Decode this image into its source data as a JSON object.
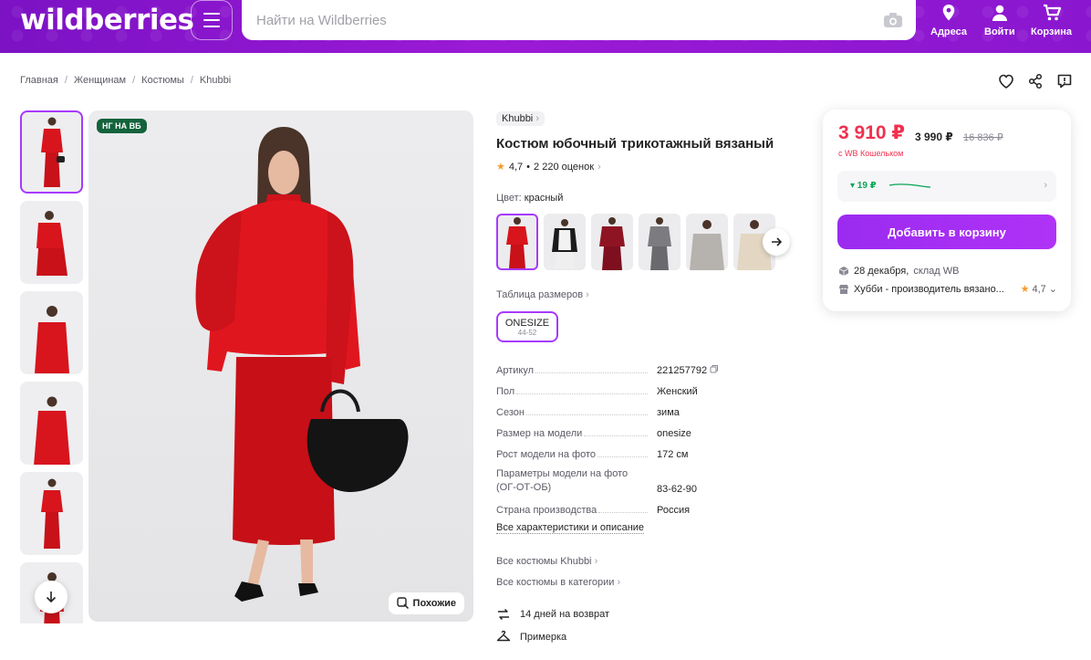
{
  "header": {
    "logo": "wildberries",
    "search_placeholder": "Найти на Wildberries",
    "addresses_label": "Адреса",
    "login_label": "Войти",
    "cart_label": "Корзина"
  },
  "breadcrumbs": [
    "Главная",
    "Женщинам",
    "Костюмы",
    "Khubbi"
  ],
  "gallery": {
    "badge": "НГ НА ВБ",
    "similar_label": "Похожие"
  },
  "product": {
    "brand": "Khubbi",
    "title": "Костюм юбочный трикотажный вязаный",
    "rating": "4,7",
    "reviews": "2 220 оценок",
    "color_label": "Цвет:",
    "color_value": "красный",
    "size_table_label": "Таблица размеров",
    "size": {
      "name": "ONESIZE",
      "range": "44-52"
    },
    "specs": [
      {
        "key": "Артикул",
        "value": "221257792"
      },
      {
        "key": "Пол",
        "value": "Женский"
      },
      {
        "key": "Сезон",
        "value": "зима"
      },
      {
        "key": "Размер на модели",
        "value": "onesize"
      },
      {
        "key": "Рост модели на фото",
        "value": "172 см"
      },
      {
        "key": "Параметры модели на фото (ОГ-ОТ-ОБ)",
        "value": "83-62-90"
      },
      {
        "key": "Страна производства",
        "value": "Россия"
      }
    ],
    "all_characteristics": "Все характеристики и описание",
    "all_brand_link": "Все костюмы Khubbi",
    "all_category_link": "Все костюмы в категории",
    "return_policy": "14 дней на возврат",
    "fitting": "Примерка"
  },
  "price_card": {
    "price": "3 910 ₽",
    "price_alt": "3 990 ₽",
    "old_price": "16 836 ₽",
    "wallet_note": "с WB Кошельком",
    "price_drop": "▾ 19 ₽",
    "add_to_cart": "Добавить в корзину",
    "delivery_date": "28 декабря,",
    "delivery_from": "склад WB",
    "seller": "Хубби - производитель вязано...",
    "seller_rating": "4,7"
  },
  "colors": {
    "accent": "#a73afd",
    "price_red": "#f1304f",
    "header": "#8a17cf",
    "drop_green": "#06a656"
  }
}
